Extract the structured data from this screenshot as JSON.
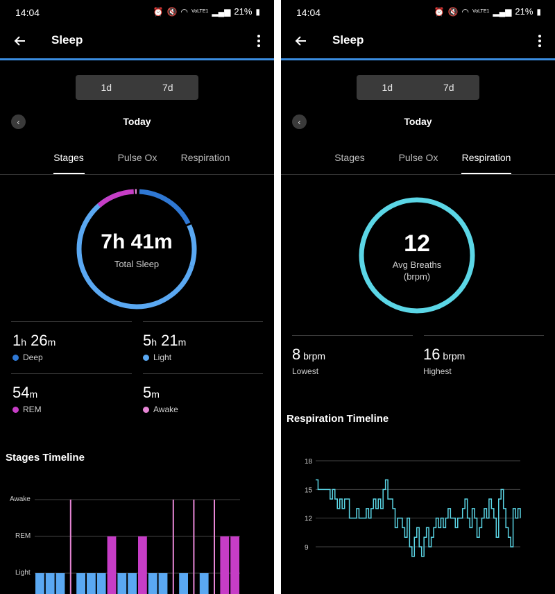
{
  "status": {
    "time": "14:04",
    "icons": [
      "alarm-icon",
      "mute-icon",
      "wifi-icon",
      "volte-icon",
      "signal-icon"
    ],
    "volte": "VoLTE1",
    "battery": "21%"
  },
  "app": {
    "title": "Sleep",
    "back": "arrow-left-icon",
    "menu": "kebab-icon"
  },
  "segments": [
    "1d",
    "7d"
  ],
  "date": {
    "label": "Today",
    "prev": "chevron-left-icon"
  },
  "tabs": [
    "Stages",
    "Pulse Ox",
    "Respiration"
  ],
  "colors": {
    "accent": "#3a8de0",
    "deep": "#2f78d4",
    "light": "#5aa8f2",
    "rem": "#c63dc6",
    "awake": "#e786d6",
    "respiration": "#5bd6e6"
  },
  "sleep": {
    "active_tab": "Stages",
    "total": "7h 41m",
    "total_label": "Total Sleep",
    "stats": [
      {
        "num1": "1",
        "unit1": "h",
        "num2": " 26",
        "unit2": "m",
        "label": "Deep",
        "color": "#2f78d4"
      },
      {
        "num1": "5",
        "unit1": "h",
        "num2": " 21",
        "unit2": "m",
        "label": "Light",
        "color": "#5aa8f2"
      },
      {
        "num1": "54",
        "unit1": "m",
        "num2": "",
        "unit2": "",
        "label": "REM",
        "color": "#c63dc6"
      },
      {
        "num1": "5",
        "unit1": "m",
        "num2": "",
        "unit2": "",
        "label": "Awake",
        "color": "#e786d6"
      }
    ],
    "timeline_title": "Stages Timeline",
    "timeline_levels": [
      "Awake",
      "REM",
      "Light"
    ]
  },
  "respiration": {
    "active_tab": "Respiration",
    "avg": "12",
    "avg_label": "Avg Breaths",
    "avg_unit": "(brpm)",
    "lowest": {
      "value": "8",
      "unit": " brpm",
      "label": "Lowest"
    },
    "highest": {
      "value": "16",
      "unit": " brpm",
      "label": "Highest"
    },
    "timeline_title": "Respiration Timeline"
  },
  "chart_data": [
    {
      "type": "bar",
      "title": "Stages Timeline",
      "categories": [
        "Awake",
        "REM",
        "Light"
      ],
      "note": "Sleep stage per time segment, left to right",
      "segments": [
        "Light",
        "Light",
        "Light",
        "Awake",
        "Light",
        "Light",
        "Light",
        "REM",
        "Light",
        "Light",
        "REM",
        "Light",
        "Light",
        "Awake",
        "Light",
        "Awake",
        "Light",
        "Awake",
        "REM",
        "REM"
      ]
    },
    {
      "type": "line",
      "title": "Respiration Timeline",
      "ylabel": "",
      "yticks": [
        18,
        15,
        12,
        9
      ],
      "ylim": [
        8,
        18
      ],
      "y": [
        16,
        15,
        15,
        15,
        15,
        15,
        14,
        15,
        14,
        13,
        14,
        13,
        14,
        14,
        12,
        12,
        12,
        13,
        12,
        12,
        12,
        13,
        12,
        13,
        14,
        13,
        14,
        13,
        15,
        16,
        14,
        14,
        13,
        11,
        12,
        12,
        11,
        10,
        12,
        9,
        8,
        10,
        11,
        9,
        8,
        10,
        11,
        9,
        10,
        11,
        12,
        11,
        12,
        11,
        12,
        13,
        12,
        12,
        11,
        12,
        12,
        13,
        14,
        12,
        11,
        13,
        12,
        10,
        11,
        12,
        13,
        12,
        14,
        13,
        12,
        10,
        14,
        15,
        13,
        11,
        10,
        9,
        13,
        12,
        13,
        12
      ]
    }
  ]
}
